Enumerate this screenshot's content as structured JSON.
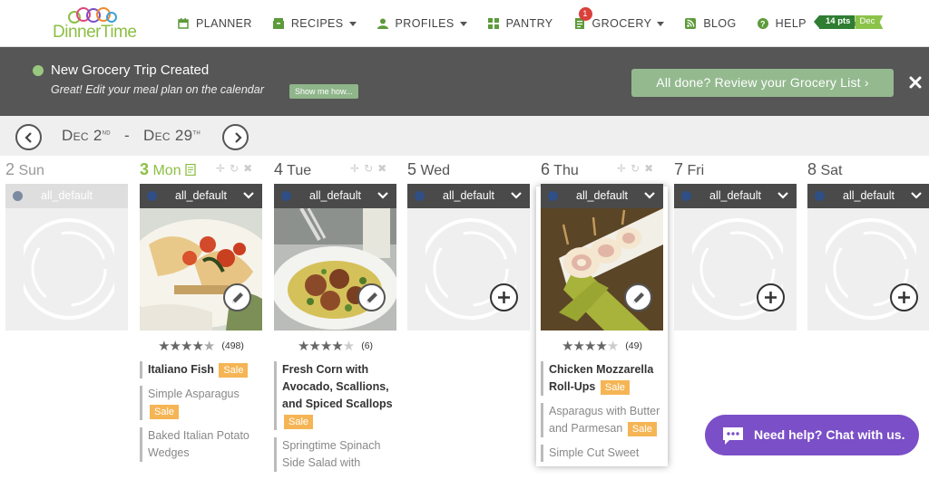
{
  "logo": {
    "text": "DinnerTime"
  },
  "nav": {
    "planner": "PLANNER",
    "recipes": "RECIPES",
    "profiles": "PROFILES",
    "pantry": "PANTRY",
    "grocery": "GROCERY",
    "grocery_count": "1",
    "blog": "BLOG",
    "help": "HELP"
  },
  "points": {
    "value": "14 pts",
    "month": "Dec"
  },
  "banner": {
    "title": "New Grocery Trip Created",
    "subtitle": "Great! Edit your meal plan on the calendar",
    "show_me": "Show me how...",
    "review": "All done? Review your Grocery List ›"
  },
  "range": {
    "start": "Dec 2",
    "start_sup": "nd",
    "sep": "-",
    "end": "Dec 29",
    "end_sup": "th"
  },
  "days": [
    {
      "num": "2",
      "name": "Sun",
      "plan": "all_default"
    },
    {
      "num": "3",
      "name": "Mon",
      "plan": "all_default"
    },
    {
      "num": "4",
      "name": "Tue",
      "plan": "all_default"
    },
    {
      "num": "5",
      "name": "Wed",
      "plan": "all_default"
    },
    {
      "num": "6",
      "name": "Thu",
      "plan": "all_default"
    },
    {
      "num": "7",
      "name": "Fri",
      "plan": "all_default"
    },
    {
      "num": "8",
      "name": "Sat",
      "plan": "all_default"
    }
  ],
  "meals": {
    "mon": {
      "stars": 4.5,
      "reviews": "(498)",
      "recipes": [
        {
          "name": "Italiano Fish",
          "sale": "Sale"
        },
        {
          "name": "Simple Asparagus",
          "sale": "Sale"
        },
        {
          "name": "Baked Italian Potato Wedges"
        }
      ]
    },
    "tue": {
      "stars": 4,
      "reviews": "(6)",
      "recipes": [
        {
          "name": "Fresh Corn with Avocado, Scallions, and Spiced Scallops",
          "sale": "Sale"
        },
        {
          "name": "Springtime Spinach Side Salad with"
        }
      ]
    },
    "thu": {
      "stars": 4,
      "reviews": "(49)",
      "recipes": [
        {
          "name": "Chicken Mozzarella Roll-Ups",
          "sale": "Sale"
        },
        {
          "name": "Asparagus with Butter and Parmesan",
          "sale": "Sale"
        },
        {
          "name": "Simple Cut Sweet"
        }
      ]
    }
  },
  "chat": {
    "label": "Need help? Chat with us."
  },
  "colors": {
    "brand_green": "#8dbf44",
    "banner": "#555655",
    "sale": "#f5b555",
    "chat": "#7b4fc7"
  }
}
